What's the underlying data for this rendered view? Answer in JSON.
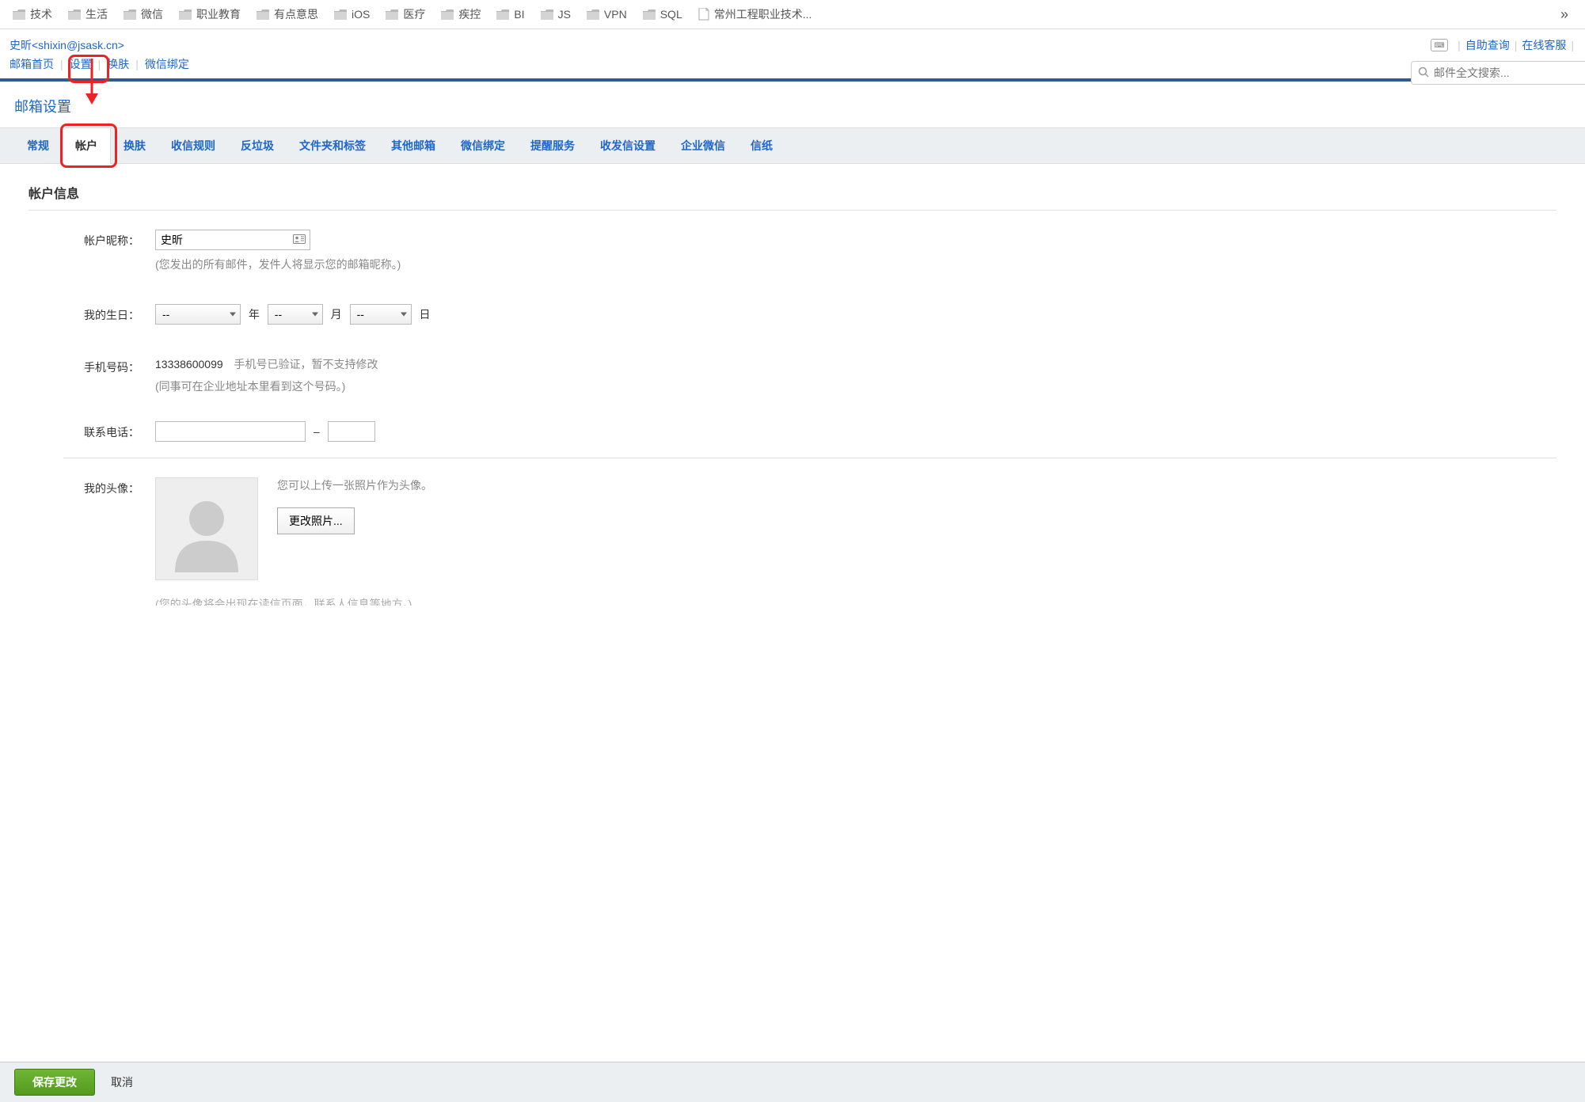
{
  "bookmarks": [
    {
      "type": "folder",
      "label": "技术"
    },
    {
      "type": "folder",
      "label": "生活"
    },
    {
      "type": "folder",
      "label": "微信"
    },
    {
      "type": "folder",
      "label": "职业教育"
    },
    {
      "type": "folder",
      "label": "有点意思"
    },
    {
      "type": "folder",
      "label": "iOS"
    },
    {
      "type": "folder",
      "label": "医疗"
    },
    {
      "type": "folder",
      "label": "疾控"
    },
    {
      "type": "folder",
      "label": "BI"
    },
    {
      "type": "folder",
      "label": "JS"
    },
    {
      "type": "folder",
      "label": "VPN"
    },
    {
      "type": "folder",
      "label": "SQL"
    },
    {
      "type": "page",
      "label": "常州工程职业技术..."
    }
  ],
  "overflow_glyph": "»",
  "header": {
    "user_display": "史昕<shixin@jsask.cn>",
    "nav": [
      "邮箱首页",
      "设置",
      "换肤",
      "微信绑定"
    ],
    "right_links": [
      "自助查询",
      "在线客服"
    ],
    "search_placeholder": "邮件全文搜索..."
  },
  "page_title": "邮箱设置",
  "tabs": [
    "常规",
    "帐户",
    "换肤",
    "收信规则",
    "反垃圾",
    "文件夹和标签",
    "其他邮箱",
    "微信绑定",
    "提醒服务",
    "收发信设置",
    "企业微信",
    "信纸"
  ],
  "account": {
    "section_title": "帐户信息",
    "nickname_label": "帐户昵称：",
    "nickname_value": "史昕",
    "nickname_hint": "(您发出的所有邮件，发件人将显示您的邮箱昵称。)",
    "birthday_label": "我的生日：",
    "birthday_year": "--",
    "birthday_month": "--",
    "birthday_day": "--",
    "year_suffix": "年",
    "month_suffix": "月",
    "day_suffix": "日",
    "mobile_label": "手机号码：",
    "mobile_value": "13338600099",
    "mobile_status": "手机号已验证，暂不支持修改",
    "mobile_hint": "(同事可在企业地址本里看到这个号码。)",
    "contact_label": "联系电话：",
    "contact_sep": "–",
    "avatar_label": "我的头像：",
    "avatar_hint": "您可以上传一张照片作为头像。",
    "change_photo": "更改照片...",
    "avatar_bottom_hint": "(您的头像将会出现在读信页面，联系人信息等地方。)"
  },
  "footer": {
    "save": "保存更改",
    "cancel": "取消"
  }
}
